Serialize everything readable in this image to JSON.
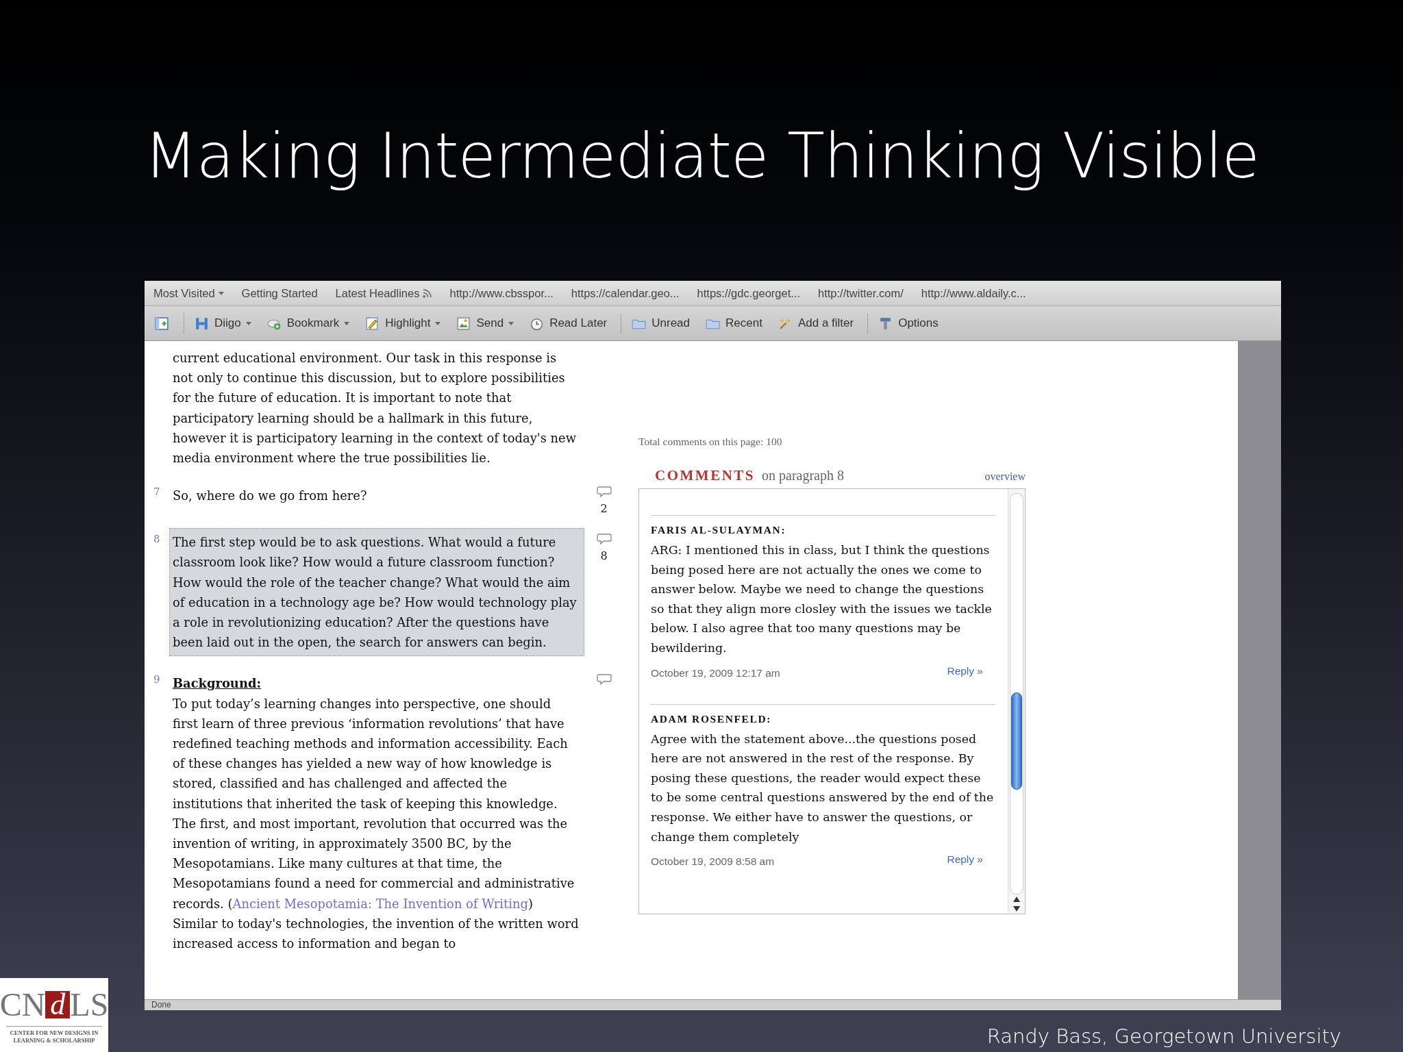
{
  "slide": {
    "title": "Making Intermediate Thinking Visible",
    "footer": "Randy Bass, Georgetown University",
    "logo": {
      "left": "CN",
      "mark": "d",
      "right": "LS",
      "tagline": [
        "CENTER FOR NEW DESIGNS IN",
        "LEARNING & SCHOLARSHIP"
      ]
    }
  },
  "browser": {
    "bookmarks": [
      {
        "label": "Most Visited",
        "dropdown": true,
        "feed": false
      },
      {
        "label": "Getting Started",
        "dropdown": false,
        "feed": false
      },
      {
        "label": "Latest Headlines",
        "dropdown": false,
        "feed": true
      },
      {
        "label": "http://www.cbsspor...",
        "dropdown": false,
        "feed": false
      },
      {
        "label": "https://calendar.geo...",
        "dropdown": false,
        "feed": false
      },
      {
        "label": "https://gdc.georget...",
        "dropdown": false,
        "feed": false
      },
      {
        "label": "http://twitter.com/",
        "dropdown": false,
        "feed": false
      },
      {
        "label": "http://www.aldaily.c...",
        "dropdown": false,
        "feed": false
      }
    ],
    "toolbar": [
      {
        "kind": "sidebar",
        "dropdown": false,
        "separator_before": false
      },
      {
        "kind": "diigo",
        "label": "Diigo",
        "dropdown": true,
        "separator_before": true
      },
      {
        "kind": "bookmark",
        "label": "Bookmark",
        "dropdown": true,
        "separator_before": false
      },
      {
        "kind": "highlight",
        "label": "Highlight",
        "dropdown": true,
        "separator_before": false
      },
      {
        "kind": "send",
        "label": "Send",
        "dropdown": true,
        "separator_before": false
      },
      {
        "kind": "later",
        "label": "Read Later",
        "dropdown": false,
        "separator_before": false
      },
      {
        "kind": "folder",
        "label": "Unread",
        "dropdown": false,
        "separator_before": true
      },
      {
        "kind": "folder",
        "label": "Recent",
        "dropdown": false,
        "separator_before": false
      },
      {
        "kind": "filter",
        "label": "Add a filter",
        "dropdown": false,
        "separator_before": false
      },
      {
        "kind": "options",
        "label": "Options",
        "dropdown": false,
        "separator_before": true
      }
    ],
    "status": "Done"
  },
  "document": {
    "paragraphs": [
      {
        "text": "current educational environment. Our task in this response is not only to continue this discussion, but to explore possibilities for the future of education. It is important to note that participatory learning should be a hallmark in this future, however it is participatory learning in the context of today's new media environment where the true possibilities lie.",
        "selected": false
      },
      {
        "number": "7",
        "text": "So, where do we go from here?",
        "selected": false,
        "comment_icon": true,
        "comment_count": "2"
      },
      {
        "number": "8",
        "text": "The first step would be to ask questions. What would a future classroom look like? How would a future classroom function? How would the role of the teacher change? What would the aim of education in a technology age be? How would technology play a role in revolutionizing education? After the questions have been laid out in the open, the search for answers can begin.",
        "selected": true,
        "comment_icon": true,
        "comment_count": "8"
      },
      {
        "number": "9",
        "heading": "Background:",
        "text": "To put today’s learning changes into perspective, one should first learn of three previous ‘information revolutions’ that have redefined teaching methods and information accessibility. Each of these changes has yielded a new way of how knowledge is stored, classified and has challenged and affected the institutions that inherited the task of keeping this knowledge. The first, and most important, revolution that occurred was the invention of writing, in approximately 3500 BC, by the Mesopotamians. Like many cultures at that time, the Mesopotamians found a need for commercial and administrative records. (",
        "link": "Ancient Mesopotamia: The Invention of Writing",
        "text_after": ") Similar to today's technologies, the invention of the written word increased access to information and began to",
        "selected": false,
        "comment_icon": true
      }
    ]
  },
  "comments_panel": {
    "total": "Total comments on this page: 100",
    "heading": "COMMENTS",
    "subheading": "on paragraph 8",
    "overview": "overview",
    "comments": [
      {
        "author": "FARIS AL-SULAYMAN:",
        "text": "ARG: I mentioned this in class, but I think the questions being posed here are not actually the ones we come to answer below. Maybe we need to change the questions so that they align more closley with the issues we tackle below. I also agree that too many questions may be bewildering.",
        "date": "October 19, 2009 12:17 am",
        "reply": "Reply »"
      },
      {
        "author": "ADAM ROSENFELD:",
        "text": "Agree with the statement above...the questions posed here are not answered in the rest of the response. By posing these questions, the reader would expect these to be some central questions answered by the end of the response. We either have to answer the questions, or change them completely",
        "date": "October 19, 2009 8:58 am",
        "reply": "Reply »"
      }
    ]
  }
}
